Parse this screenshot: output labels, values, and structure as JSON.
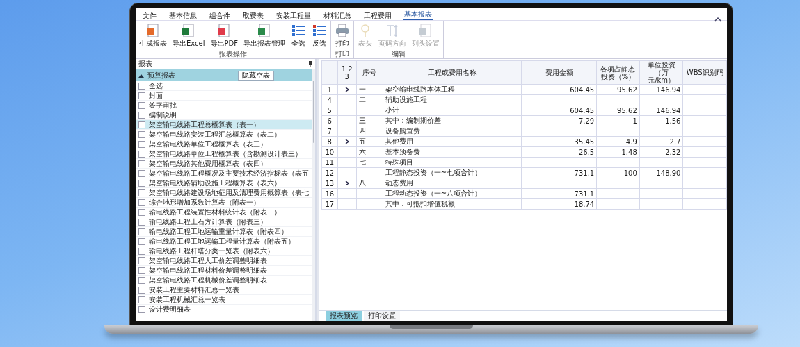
{
  "menu_tabs": [
    {
      "label": "文件",
      "selected": false
    },
    {
      "label": "基本信息",
      "selected": false
    },
    {
      "label": "组合件",
      "selected": false
    },
    {
      "label": "取费表",
      "selected": false
    },
    {
      "label": "安装工程量",
      "selected": false
    },
    {
      "label": "材料汇总",
      "selected": false
    },
    {
      "label": "工程费用",
      "selected": false
    },
    {
      "label": "基本报表",
      "selected": true
    }
  ],
  "ribbon_groups": [
    {
      "label": "报表操作",
      "buttons": [
        {
          "kind": "generate",
          "label": "生成报表",
          "disabled": false
        },
        {
          "kind": "excel",
          "label": "导出Excel",
          "disabled": false
        },
        {
          "kind": "pdf",
          "label": "导出PDF",
          "disabled": false
        },
        {
          "kind": "export",
          "label": "导出报表管理",
          "disabled": false
        },
        {
          "kind": "list",
          "label": "全选",
          "disabled": false
        },
        {
          "kind": "list2",
          "label": "反选",
          "disabled": false
        }
      ]
    },
    {
      "label": "打印",
      "buttons": [
        {
          "kind": "printer",
          "label": "打印",
          "disabled": false
        }
      ]
    },
    {
      "label": "编辑",
      "buttons": [
        {
          "kind": "pin",
          "label": "表头",
          "disabled": true
        },
        {
          "kind": "text",
          "label": "页码方向",
          "disabled": true
        },
        {
          "kind": "window",
          "label": "列头设置",
          "disabled": true
        }
      ]
    }
  ],
  "report_panel": {
    "title": "报表",
    "group": {
      "label": "预算报表",
      "expanded": true,
      "hide_button": "隐藏空表"
    },
    "select_all": {
      "label": "全选",
      "checked": false
    },
    "items": [
      {
        "label": "封面",
        "checked": false,
        "selected": false
      },
      {
        "label": "签字审批",
        "checked": false,
        "selected": false
      },
      {
        "label": "编制说明",
        "checked": false,
        "selected": false
      },
      {
        "label": "架空输电线路工程总概算表（表一）",
        "checked": false,
        "selected": true
      },
      {
        "label": "架空输电线路安装工程汇总概算表（表二）",
        "checked": false,
        "selected": false
      },
      {
        "label": "架空输电线路单位工程概算表（表三）",
        "checked": false,
        "selected": false
      },
      {
        "label": "架空输电线路单位工程概算表（含勘测设计表三）",
        "checked": false,
        "selected": false
      },
      {
        "label": "架空输电线路其他费用概算表（表四）",
        "checked": false,
        "selected": false
      },
      {
        "label": "架空输电线路工程概况及主要技术经济指标表（表五",
        "checked": false,
        "selected": false
      },
      {
        "label": "架空输电线路辅助设施工程概算表（表六）",
        "checked": false,
        "selected": false
      },
      {
        "label": "架空输电线路建设场地征用及清理费用概算表（表七",
        "checked": false,
        "selected": false
      },
      {
        "label": "综合地形增加系数计算表（附表一）",
        "checked": false,
        "selected": false
      },
      {
        "label": "输电线路工程装置性材料统计表（附表二）",
        "checked": false,
        "selected": false
      },
      {
        "label": "输电线路工程土石方计算表（附表三）",
        "checked": false,
        "selected": false
      },
      {
        "label": "输电线路工程工地运输重量计算表（附表四）",
        "checked": false,
        "selected": false
      },
      {
        "label": "输电线路工程工地运输工程量计算表（附表五）",
        "checked": false,
        "selected": false
      },
      {
        "label": "输电线路工程杆塔分类一览表（附表六）",
        "checked": false,
        "selected": false
      },
      {
        "label": "架空输电线路工程人工价差调整明细表",
        "checked": false,
        "selected": false
      },
      {
        "label": "架空输电线路工程材料价差调整明细表",
        "checked": false,
        "selected": false
      },
      {
        "label": "架空输电线路工程机械价差调整明细表",
        "checked": false,
        "selected": false
      },
      {
        "label": "安装工程主要材料汇总一览表",
        "checked": false,
        "selected": false
      },
      {
        "label": "安装工程机械汇总一览表",
        "checked": false,
        "selected": false
      },
      {
        "label": "设计费明细表",
        "checked": false,
        "selected": false
      }
    ]
  },
  "table": {
    "columns": [
      "1 2 3",
      "序号",
      "工程或费用名称",
      "费用金额",
      "各项占静态投资（%）",
      "单位投资（万元/km）",
      "WBS识别码"
    ],
    "rows": [
      {
        "num": "1",
        "collapsible": true,
        "seq": "一",
        "name": "架空输电线路本体工程",
        "amount": "604.45",
        "pct": "95.62",
        "unit": "146.94"
      },
      {
        "num": "4",
        "collapsible": false,
        "seq": "二",
        "name": "辅助设施工程"
      },
      {
        "num": "5",
        "collapsible": false,
        "name": "小计",
        "amount": "604.45",
        "pct": "95.62",
        "unit": "146.94"
      },
      {
        "num": "6",
        "collapsible": false,
        "seq": "三",
        "name": "其中：编制期价差",
        "amount": "7.29",
        "pct": "1",
        "unit": "1.56"
      },
      {
        "num": "7",
        "collapsible": false,
        "seq": "四",
        "name": "设备购置费"
      },
      {
        "num": "8",
        "collapsible": true,
        "seq": "五",
        "name": "其他费用",
        "amount": "35.45",
        "pct": "4.9",
        "unit": "2.7"
      },
      {
        "num": "10",
        "collapsible": false,
        "seq": "六",
        "name": "基本预备费",
        "amount": "26.5",
        "pct": "1.48",
        "unit": "2.32"
      },
      {
        "num": "11",
        "collapsible": false,
        "seq": "七",
        "name": "特殊项目"
      },
      {
        "num": "12",
        "collapsible": false,
        "name": "工程静态投资（一~七项合计）",
        "amount": "731.1",
        "pct": "100",
        "unit": "148.90"
      },
      {
        "num": "13",
        "collapsible": true,
        "seq": "八",
        "name": "动态费用"
      },
      {
        "num": "16",
        "collapsible": false,
        "name": "工程动态投资（一~八项合计）",
        "amount": "731.1"
      },
      {
        "num": "17",
        "collapsible": false,
        "name": "其中：可抵扣增值税额",
        "amount": "18.74"
      }
    ]
  },
  "bottom_tabs": [
    {
      "label": "报表预览",
      "selected": true
    },
    {
      "label": "打印设置",
      "selected": false
    }
  ]
}
